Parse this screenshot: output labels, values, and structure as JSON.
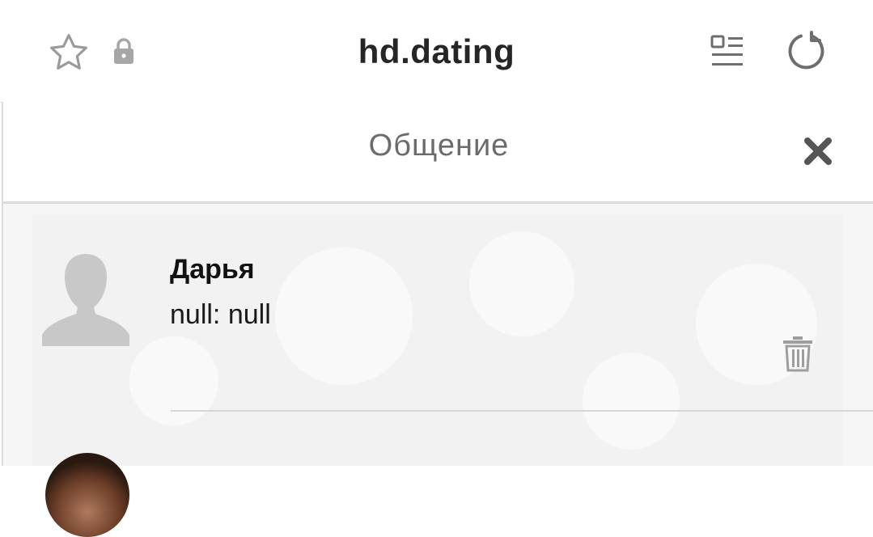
{
  "browser": {
    "site_title": "hd.dating",
    "icons": [
      "star-icon",
      "lock-icon",
      "reader-mode-icon",
      "reload-icon"
    ]
  },
  "dialog": {
    "title": "Общение",
    "close_icon": "close-icon"
  },
  "conversations": [
    {
      "name": "Дарья",
      "preview": "null: null",
      "avatar": "default-avatar-icon",
      "action_icon": "trash-icon"
    }
  ],
  "colors": {
    "header_text": "#262626",
    "dialog_title": "#6b6b6b",
    "icon_gray": "#9e9e9e",
    "close_gray": "#555555",
    "avatar_gray": "#c8c8c8"
  }
}
